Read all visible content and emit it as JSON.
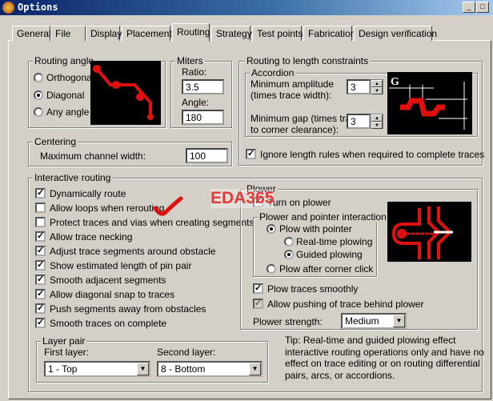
{
  "window": {
    "title": "Options",
    "minimize": "_",
    "maximize": "□"
  },
  "tabs": [
    "General",
    "File",
    "Display",
    "Placement",
    "Routing",
    "Strategy",
    "Test points",
    "Fabrication",
    "Design verification"
  ],
  "routing_angle": {
    "label": "Routing angle",
    "options": [
      "Orthogonal",
      "Diagonal",
      "Any angle"
    ],
    "selected": "Diagonal"
  },
  "miters": {
    "label": "Miters",
    "ratio_label": "Ratio:",
    "ratio": "3.5",
    "angle_label": "Angle:",
    "angle": "180"
  },
  "centering": {
    "label": "Centering",
    "max_width_label": "Maximum channel width:",
    "max_width": "100"
  },
  "length": {
    "label": "Routing to length constraints",
    "accordion": "Accordion",
    "amp_label1": "Minimum amplitude",
    "amp_label2": "(times trace width):",
    "amp": "3",
    "gap_label1": "Minimum gap (times trace",
    "gap_label2": "to corner clearance):",
    "gap": "3",
    "ignore": "Ignore length rules when required to complete traces",
    "ignore_checked": true,
    "diagram_letter": "G"
  },
  "interactive": {
    "label": "Interactive routing",
    "items": [
      {
        "label": "Dynamically route",
        "checked": true
      },
      {
        "label": "Allow loops when rerouting",
        "checked": false
      },
      {
        "label": "Protect traces and vias when creating segments",
        "checked": false
      },
      {
        "label": "Allow trace necking",
        "checked": true
      },
      {
        "label": "Adjust trace segments around obstacle",
        "checked": true
      },
      {
        "label": "Show estimated length of pin pair",
        "checked": true
      },
      {
        "label": "Smooth adjacent segments",
        "checked": true
      },
      {
        "label": "Allow diagonal snap to traces",
        "checked": true
      },
      {
        "label": "Push segments away from obstacles",
        "checked": true
      },
      {
        "label": "Smooth traces on complete",
        "checked": true
      }
    ]
  },
  "plower": {
    "label": "Plower",
    "turn_on": "Turn on plower",
    "interaction": "Plower and pointer interaction",
    "with_pointer": "Plow with pointer",
    "realtime": "Real-time plowing",
    "guided": "Guided plowing",
    "after_corner": "Plow after corner click",
    "smoothly": "Plow traces smoothly",
    "pushing": "Allow pushing of trace behind plower",
    "strength_label": "Plower strength:",
    "strength": "Medium"
  },
  "layer_pair": {
    "label": "Layer pair",
    "first_label": "First layer:",
    "first": "1 - Top",
    "second_label": "Second layer:",
    "second": "8 - Bottom"
  },
  "tip": [
    "Tip: Real-time and guided plowing effect",
    "interactive routing operations only and have no",
    "effect on trace editing or on routing differential",
    "pairs, arcs, or accordions."
  ],
  "watermark": "EDA365",
  "colors": {
    "trace": "#e01010"
  }
}
